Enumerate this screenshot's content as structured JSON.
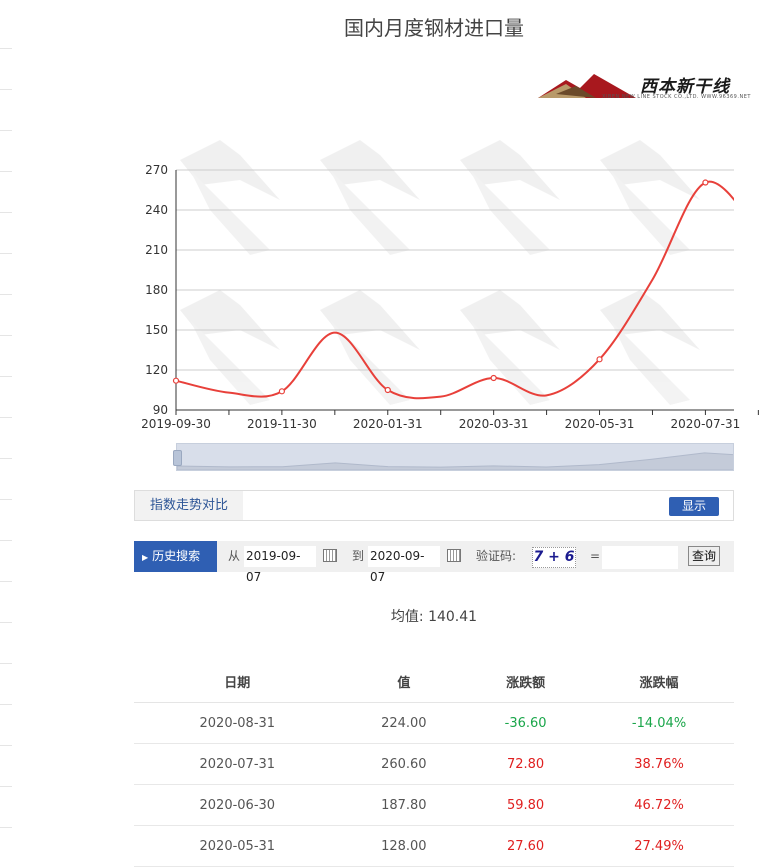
{
  "title": "国内月度钢材进口量",
  "logo": {
    "brand": "西本新干线",
    "sub": "XIBEN NEW LINE STOCK CO.,LTD. WWW.96369.NET"
  },
  "chart_data": {
    "type": "line",
    "x": [
      "2019-09-30",
      "2019-10-31",
      "2019-11-30",
      "2019-12-31",
      "2020-01-31",
      "2020-02-29",
      "2020-03-31",
      "2020-04-30",
      "2020-05-31",
      "2020-06-30",
      "2020-07-31",
      "2020-08-31"
    ],
    "values": [
      112,
      103,
      104,
      148,
      105,
      100,
      114,
      101,
      128,
      187.8,
      260.6,
      224
    ],
    "tick_labels": [
      "2019-09-30",
      "2019-11-30",
      "2020-01-31",
      "2020-03-31",
      "2020-05-31",
      "2020-07-31"
    ],
    "yticks": [
      90,
      120,
      150,
      180,
      210,
      240,
      270
    ],
    "ylim": [
      90,
      270
    ],
    "grid": true,
    "line_color": "#e8403a"
  },
  "compare": {
    "label": "指数走势对比",
    "button": "显示"
  },
  "search": {
    "tab": "历史搜索",
    "from_label": "从",
    "from_value": "2019-09-07",
    "to_label": "到",
    "to_value": "2020-09-07",
    "captcha_label": "验证码:",
    "captcha": "7 + 6",
    "equals": "=",
    "button": "查询"
  },
  "average": "均值: 140.41",
  "table": {
    "headers": [
      "日期",
      "值",
      "涨跌额",
      "涨跌幅"
    ],
    "rows": [
      [
        "2020-08-31",
        "224.00",
        "-36.60",
        "-14.04%"
      ],
      [
        "2020-07-31",
        "260.60",
        "72.80",
        "38.76%"
      ],
      [
        "2020-06-30",
        "187.80",
        "59.80",
        "46.72%"
      ],
      [
        "2020-05-31",
        "128.00",
        "27.60",
        "27.49%"
      ]
    ]
  }
}
